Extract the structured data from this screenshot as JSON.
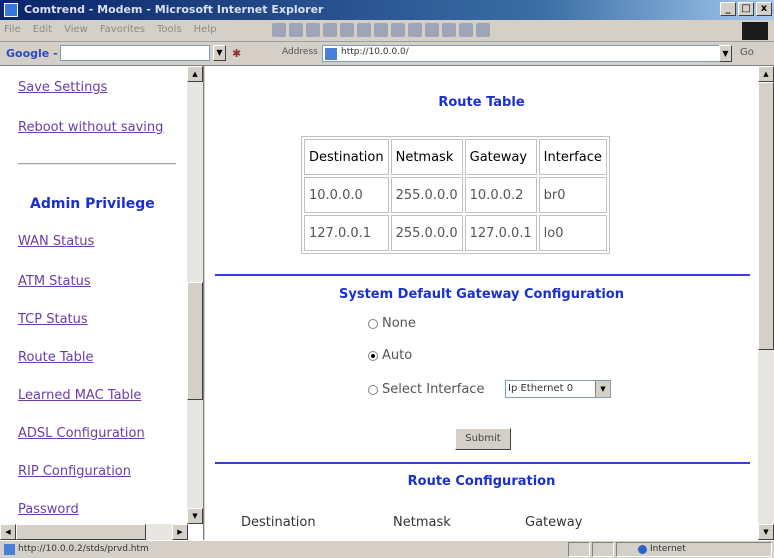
{
  "window": {
    "title": "Comtrend - Modem - Microsoft Internet Explorer",
    "controls": [
      "_",
      "ё",
      "x"
    ]
  },
  "menu": [
    "File",
    "Edit",
    "View",
    "Favorites",
    "Tools",
    "Help"
  ],
  "google_bar": {
    "logo": "Google -"
  },
  "address_bar": {
    "label": "Address",
    "url": "http://10.0.0.0/",
    "go": "Go"
  },
  "sidebar": {
    "links": {
      "save_settings": "Save Settings",
      "reboot": "Reboot without saving",
      "wan_status": "WAN Status",
      "atm_status": "ATM Status",
      "tcp_status": "TCP Status",
      "route_table": "Route Table",
      "learned_mac": "Learned MAC Table",
      "adsl_config": "ADSL Configuration",
      "rip_config": "RIP Configuration",
      "password": "Password"
    },
    "section_title": "Admin Privilege"
  },
  "route_table": {
    "title": "Route Table",
    "columns": [
      "Destination",
      "Netmask",
      "Gateway",
      "Interface"
    ],
    "rows": [
      [
        "10.0.0.0",
        "255.0.0.0",
        "10.0.0.2",
        "br0"
      ],
      [
        "127.0.0.1",
        "255.0.0.0",
        "127.0.0.1",
        "lo0"
      ]
    ]
  },
  "gateway_config": {
    "title": "System Default Gateway Configuration",
    "options": [
      "None",
      "Auto",
      "Select Interface"
    ],
    "selected": "Auto",
    "interface_value": "Ip Ethernet 0",
    "submit_label": "Submit"
  },
  "route_config": {
    "title": "Route Configuration",
    "columns": [
      "Destination",
      "Netmask",
      "Gateway"
    ]
  },
  "status_bar": {
    "text": "http://10.0.0.2/stds/prvd.htm",
    "zone": "Internet"
  }
}
